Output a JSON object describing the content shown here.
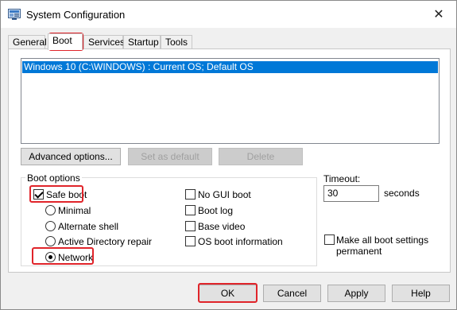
{
  "window": {
    "title": "System Configuration"
  },
  "tabs": [
    "General",
    "Boot",
    "Services",
    "Startup",
    "Tools"
  ],
  "os_list": [
    "Windows 10 (C:\\WINDOWS) : Current OS; Default OS"
  ],
  "buttons": {
    "advanced": "Advanced options...",
    "set_default": "Set as default",
    "delete": "Delete"
  },
  "boot_options": {
    "label": "Boot options",
    "safe_boot": "Safe boot",
    "minimal": "Minimal",
    "alternate_shell": "Alternate shell",
    "active_directory_repair": "Active Directory repair",
    "network": "Network",
    "no_gui_boot": "No GUI boot",
    "boot_log": "Boot log",
    "base_video": "Base video",
    "os_boot_information": "OS boot information"
  },
  "timeout": {
    "label": "Timeout:",
    "value": "30",
    "unit": "seconds"
  },
  "make_permanent": "Make all boot settings permanent",
  "footer": {
    "ok": "OK",
    "cancel": "Cancel",
    "apply": "Apply",
    "help": "Help"
  }
}
